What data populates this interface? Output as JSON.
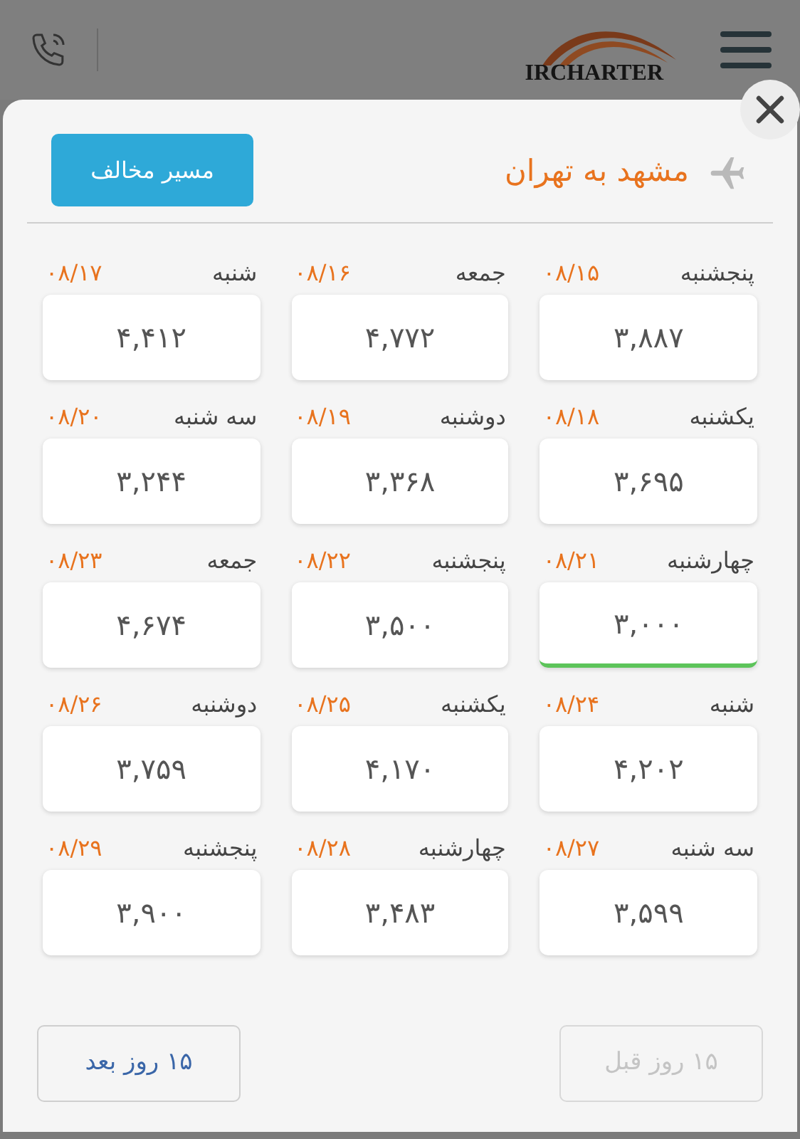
{
  "header": {
    "logo": "IRCHARTER"
  },
  "modal": {
    "route": "مشهد به تهران",
    "reverse_button": "مسیر مخالف",
    "days": [
      {
        "weekday": "پنجشنبه",
        "date": "۰۸/۱۵",
        "price": "۳,۸۸۷",
        "selected": false
      },
      {
        "weekday": "جمعه",
        "date": "۰۸/۱۶",
        "price": "۴,۷۷۲",
        "selected": false
      },
      {
        "weekday": "شنبه",
        "date": "۰۸/۱۷",
        "price": "۴,۴۱۲",
        "selected": false
      },
      {
        "weekday": "یکشنبه",
        "date": "۰۸/۱۸",
        "price": "۳,۶۹۵",
        "selected": false
      },
      {
        "weekday": "دوشنبه",
        "date": "۰۸/۱۹",
        "price": "۳,۳۶۸",
        "selected": false
      },
      {
        "weekday": "سه شنبه",
        "date": "۰۸/۲۰",
        "price": "۳,۲۴۴",
        "selected": false
      },
      {
        "weekday": "چهارشنبه",
        "date": "۰۸/۲۱",
        "price": "۳,۰۰۰",
        "selected": true
      },
      {
        "weekday": "پنجشنبه",
        "date": "۰۸/۲۲",
        "price": "۳,۵۰۰",
        "selected": false
      },
      {
        "weekday": "جمعه",
        "date": "۰۸/۲۳",
        "price": "۴,۶۷۴",
        "selected": false
      },
      {
        "weekday": "شنبه",
        "date": "۰۸/۲۴",
        "price": "۴,۲۰۲",
        "selected": false
      },
      {
        "weekday": "یکشنبه",
        "date": "۰۸/۲۵",
        "price": "۴,۱۷۰",
        "selected": false
      },
      {
        "weekday": "دوشنبه",
        "date": "۰۸/۲۶",
        "price": "۳,۷۵۹",
        "selected": false
      },
      {
        "weekday": "سه شنبه",
        "date": "۰۸/۲۷",
        "price": "۳,۵۹۹",
        "selected": false
      },
      {
        "weekday": "چهارشنبه",
        "date": "۰۸/۲۸",
        "price": "۳,۴۸۳",
        "selected": false
      },
      {
        "weekday": "پنجشنبه",
        "date": "۰۸/۲۹",
        "price": "۳,۹۰۰",
        "selected": false
      }
    ],
    "prev_button": {
      "label": "۱۵ روز قبل",
      "disabled": true
    },
    "next_button": {
      "label": "۱۵ روز بعد",
      "disabled": false
    }
  }
}
